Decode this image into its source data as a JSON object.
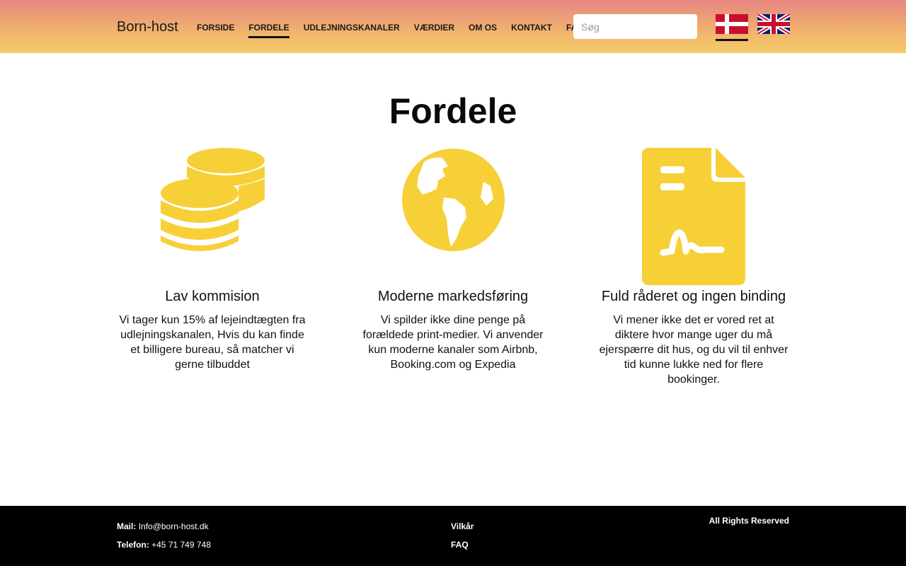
{
  "header": {
    "brand": "Born-host",
    "nav": [
      {
        "label": "FORSIDE",
        "active": false
      },
      {
        "label": "FORDELE",
        "active": true
      },
      {
        "label": "UDLEJNINGSKANALER",
        "active": false
      },
      {
        "label": "VÆRDIER",
        "active": false
      },
      {
        "label": "OM OS",
        "active": false
      },
      {
        "label": "KONTAKT",
        "active": false
      },
      {
        "label": "FAQ",
        "active": false
      }
    ],
    "search_placeholder": "Søg",
    "languages": [
      "danish-flag-icon",
      "uk-flag-icon"
    ],
    "active_language": "danish-flag-icon"
  },
  "main": {
    "title": "Fordele",
    "features": [
      {
        "icon": "coins-icon",
        "heading": "Lav kommision",
        "text": "Vi tager kun 15% af lejeindtægten fra udlejningskanalen, Hvis du kan finde et billigere bureau, så matcher vi gerne tilbuddet"
      },
      {
        "icon": "globe-icon",
        "heading": "Moderne markedsføring",
        "text": "Vi spilder ikke dine penge på forældede print-medier. Vi anvender kun moderne kanaler som Airbnb, Booking.com og Expedia"
      },
      {
        "icon": "signed-document-icon",
        "heading": "Fuld råderet og ingen binding",
        "text": "Vi mener ikke det er vored ret at diktere hvor mange uger du må ejerspærre dit hus, og du vil til enhver tid kunne lukke ned for flere bookinger."
      }
    ]
  },
  "footer": {
    "mail_label": "Mail:",
    "mail_value": "Info@born-host.dk",
    "phone_label": "Telefon:",
    "phone_value": "+45 71 749 748",
    "links": [
      "Vilkår",
      "FAQ"
    ],
    "rights": "All Rights Reserved"
  },
  "colors": {
    "accent_icon": "#f7d038",
    "header_top": "#e88582",
    "header_bottom": "#f4cc68",
    "footer_bg": "#000000"
  }
}
